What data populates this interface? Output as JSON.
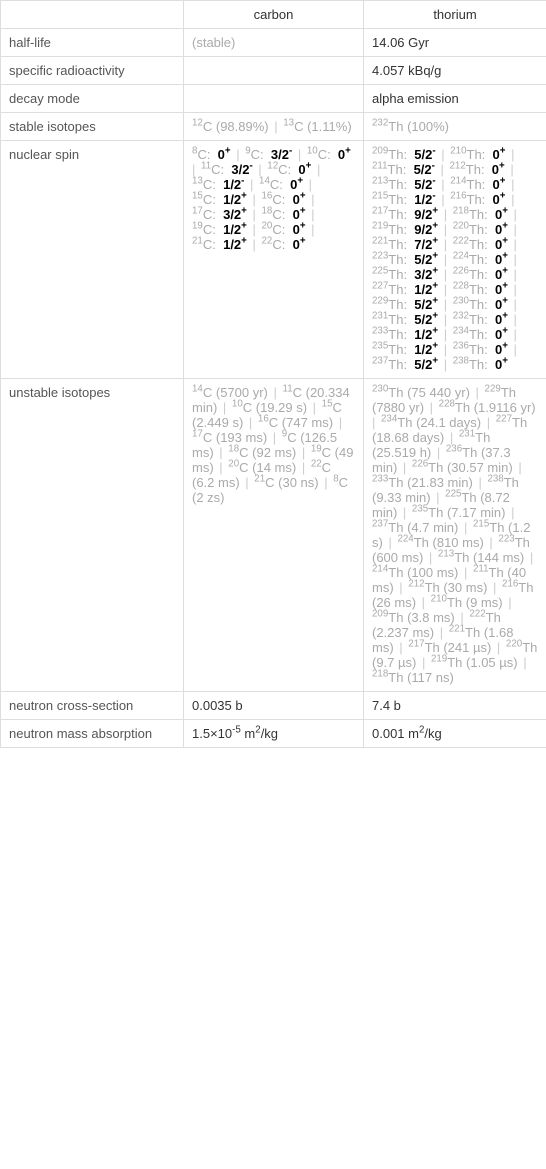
{
  "headers": {
    "col1": "carbon",
    "col2": "thorium"
  },
  "rows": {
    "half_life": {
      "label": "half-life",
      "carbon": "(stable)",
      "thorium": "14.06 Gyr"
    },
    "spec_radio": {
      "label": "specific radioactivity",
      "carbon": "",
      "thorium": "4.057 kBq/g"
    },
    "decay_mode": {
      "label": "decay mode",
      "carbon": "",
      "thorium": "alpha emission"
    },
    "stable_isotopes": {
      "label": "stable isotopes",
      "carbon": [
        {
          "mass": "12",
          "sym": "C",
          "note": " (98.89%)"
        },
        {
          "mass": "13",
          "sym": "C",
          "note": " (1.11%)"
        }
      ],
      "thorium": [
        {
          "mass": "232",
          "sym": "Th",
          "note": " (100%)"
        }
      ]
    },
    "nuclear_spin": {
      "label": "nuclear spin",
      "carbon": [
        {
          "mass": "8",
          "sym": "C",
          "spin": "0",
          "sign": "+"
        },
        {
          "mass": "9",
          "sym": "C",
          "spin": "3/2",
          "sign": "-"
        },
        {
          "mass": "10",
          "sym": "C",
          "spin": "0",
          "sign": "+"
        },
        {
          "mass": "11",
          "sym": "C",
          "spin": "3/2",
          "sign": "-"
        },
        {
          "mass": "12",
          "sym": "C",
          "spin": "0",
          "sign": "+"
        },
        {
          "mass": "13",
          "sym": "C",
          "spin": "1/2",
          "sign": "-"
        },
        {
          "mass": "14",
          "sym": "C",
          "spin": "0",
          "sign": "+"
        },
        {
          "mass": "15",
          "sym": "C",
          "spin": "1/2",
          "sign": "+"
        },
        {
          "mass": "16",
          "sym": "C",
          "spin": "0",
          "sign": "+"
        },
        {
          "mass": "17",
          "sym": "C",
          "spin": "3/2",
          "sign": "+"
        },
        {
          "mass": "18",
          "sym": "C",
          "spin": "0",
          "sign": "+"
        },
        {
          "mass": "19",
          "sym": "C",
          "spin": "1/2",
          "sign": "+"
        },
        {
          "mass": "20",
          "sym": "C",
          "spin": "0",
          "sign": "+"
        },
        {
          "mass": "21",
          "sym": "C",
          "spin": "1/2",
          "sign": "+"
        },
        {
          "mass": "22",
          "sym": "C",
          "spin": "0",
          "sign": "+"
        }
      ],
      "thorium": [
        {
          "mass": "209",
          "sym": "Th",
          "spin": "5/2",
          "sign": "-"
        },
        {
          "mass": "210",
          "sym": "Th",
          "spin": "0",
          "sign": "+"
        },
        {
          "mass": "211",
          "sym": "Th",
          "spin": "5/2",
          "sign": "-"
        },
        {
          "mass": "212",
          "sym": "Th",
          "spin": "0",
          "sign": "+"
        },
        {
          "mass": "213",
          "sym": "Th",
          "spin": "5/2",
          "sign": "-"
        },
        {
          "mass": "214",
          "sym": "Th",
          "spin": "0",
          "sign": "+"
        },
        {
          "mass": "215",
          "sym": "Th",
          "spin": "1/2",
          "sign": "-"
        },
        {
          "mass": "216",
          "sym": "Th",
          "spin": "0",
          "sign": "+"
        },
        {
          "mass": "217",
          "sym": "Th",
          "spin": "9/2",
          "sign": "+"
        },
        {
          "mass": "218",
          "sym": "Th",
          "spin": "0",
          "sign": "+"
        },
        {
          "mass": "219",
          "sym": "Th",
          "spin": "9/2",
          "sign": "+"
        },
        {
          "mass": "220",
          "sym": "Th",
          "spin": "0",
          "sign": "+"
        },
        {
          "mass": "221",
          "sym": "Th",
          "spin": "7/2",
          "sign": "+"
        },
        {
          "mass": "222",
          "sym": "Th",
          "spin": "0",
          "sign": "+"
        },
        {
          "mass": "223",
          "sym": "Th",
          "spin": "5/2",
          "sign": "+"
        },
        {
          "mass": "224",
          "sym": "Th",
          "spin": "0",
          "sign": "+"
        },
        {
          "mass": "225",
          "sym": "Th",
          "spin": "3/2",
          "sign": "+"
        },
        {
          "mass": "226",
          "sym": "Th",
          "spin": "0",
          "sign": "+"
        },
        {
          "mass": "227",
          "sym": "Th",
          "spin": "1/2",
          "sign": "+"
        },
        {
          "mass": "228",
          "sym": "Th",
          "spin": "0",
          "sign": "+"
        },
        {
          "mass": "229",
          "sym": "Th",
          "spin": "5/2",
          "sign": "+"
        },
        {
          "mass": "230",
          "sym": "Th",
          "spin": "0",
          "sign": "+"
        },
        {
          "mass": "231",
          "sym": "Th",
          "spin": "5/2",
          "sign": "+"
        },
        {
          "mass": "232",
          "sym": "Th",
          "spin": "0",
          "sign": "+"
        },
        {
          "mass": "233",
          "sym": "Th",
          "spin": "1/2",
          "sign": "+"
        },
        {
          "mass": "234",
          "sym": "Th",
          "spin": "0",
          "sign": "+"
        },
        {
          "mass": "235",
          "sym": "Th",
          "spin": "1/2",
          "sign": "+"
        },
        {
          "mass": "236",
          "sym": "Th",
          "spin": "0",
          "sign": "+"
        },
        {
          "mass": "237",
          "sym": "Th",
          "spin": "5/2",
          "sign": "+"
        },
        {
          "mass": "238",
          "sym": "Th",
          "spin": "0",
          "sign": "+"
        }
      ]
    },
    "unstable_isotopes": {
      "label": "unstable isotopes",
      "carbon": [
        {
          "mass": "14",
          "sym": "C",
          "note": " (5700 yr)"
        },
        {
          "mass": "11",
          "sym": "C",
          "note": " (20.334 min)"
        },
        {
          "mass": "10",
          "sym": "C",
          "note": " (19.29 s)"
        },
        {
          "mass": "15",
          "sym": "C",
          "note": " (2.449 s)"
        },
        {
          "mass": "16",
          "sym": "C",
          "note": " (747 ms)"
        },
        {
          "mass": "17",
          "sym": "C",
          "note": " (193 ms)"
        },
        {
          "mass": "9",
          "sym": "C",
          "note": " (126.5 ms)"
        },
        {
          "mass": "18",
          "sym": "C",
          "note": " (92 ms)"
        },
        {
          "mass": "19",
          "sym": "C",
          "note": " (49 ms)"
        },
        {
          "mass": "20",
          "sym": "C",
          "note": " (14 ms)"
        },
        {
          "mass": "22",
          "sym": "C",
          "note": " (6.2 ms)"
        },
        {
          "mass": "21",
          "sym": "C",
          "note": " (30 ns)"
        },
        {
          "mass": "8",
          "sym": "C",
          "note": " (2 zs)"
        }
      ],
      "thorium": [
        {
          "mass": "230",
          "sym": "Th",
          "note": " (75 440 yr)"
        },
        {
          "mass": "229",
          "sym": "Th",
          "note": " (7880 yr)"
        },
        {
          "mass": "228",
          "sym": "Th",
          "note": " (1.9116 yr)"
        },
        {
          "mass": "234",
          "sym": "Th",
          "note": " (24.1 days)"
        },
        {
          "mass": "227",
          "sym": "Th",
          "note": " (18.68 days)"
        },
        {
          "mass": "231",
          "sym": "Th",
          "note": " (25.519 h)"
        },
        {
          "mass": "236",
          "sym": "Th",
          "note": " (37.3 min)"
        },
        {
          "mass": "226",
          "sym": "Th",
          "note": " (30.57 min)"
        },
        {
          "mass": "233",
          "sym": "Th",
          "note": " (21.83 min)"
        },
        {
          "mass": "238",
          "sym": "Th",
          "note": " (9.33 min)"
        },
        {
          "mass": "225",
          "sym": "Th",
          "note": " (8.72 min)"
        },
        {
          "mass": "235",
          "sym": "Th",
          "note": " (7.17 min)"
        },
        {
          "mass": "237",
          "sym": "Th",
          "note": " (4.7 min)"
        },
        {
          "mass": "215",
          "sym": "Th",
          "note": " (1.2 s)"
        },
        {
          "mass": "224",
          "sym": "Th",
          "note": " (810 ms)"
        },
        {
          "mass": "223",
          "sym": "Th",
          "note": " (600 ms)"
        },
        {
          "mass": "213",
          "sym": "Th",
          "note": " (144 ms)"
        },
        {
          "mass": "214",
          "sym": "Th",
          "note": " (100 ms)"
        },
        {
          "mass": "211",
          "sym": "Th",
          "note": " (40 ms)"
        },
        {
          "mass": "212",
          "sym": "Th",
          "note": " (30 ms)"
        },
        {
          "mass": "216",
          "sym": "Th",
          "note": " (26 ms)"
        },
        {
          "mass": "210",
          "sym": "Th",
          "note": " (9 ms)"
        },
        {
          "mass": "209",
          "sym": "Th",
          "note": " (3.8 ms)"
        },
        {
          "mass": "222",
          "sym": "Th",
          "note": " (2.237 ms)"
        },
        {
          "mass": "221",
          "sym": "Th",
          "note": " (1.68 ms)"
        },
        {
          "mass": "217",
          "sym": "Th",
          "note": " (241 µs)"
        },
        {
          "mass": "220",
          "sym": "Th",
          "note": " (9.7 µs)"
        },
        {
          "mass": "219",
          "sym": "Th",
          "note": " (1.05 µs)"
        },
        {
          "mass": "218",
          "sym": "Th",
          "note": " (117 ns)"
        }
      ]
    },
    "neutron_cs": {
      "label": "neutron cross-section",
      "carbon": "0.0035 b",
      "thorium": "7.4 b"
    },
    "neutron_mass_abs": {
      "label": "neutron mass absorption",
      "carbon_pre": "1.5×10",
      "carbon_sup": "-5",
      "carbon_post": " m",
      "carbon_sup2": "2",
      "carbon_tail": "/kg",
      "thorium_pre": "0.001 m",
      "thorium_sup": "2",
      "thorium_post": "/kg"
    }
  },
  "separator": " | "
}
